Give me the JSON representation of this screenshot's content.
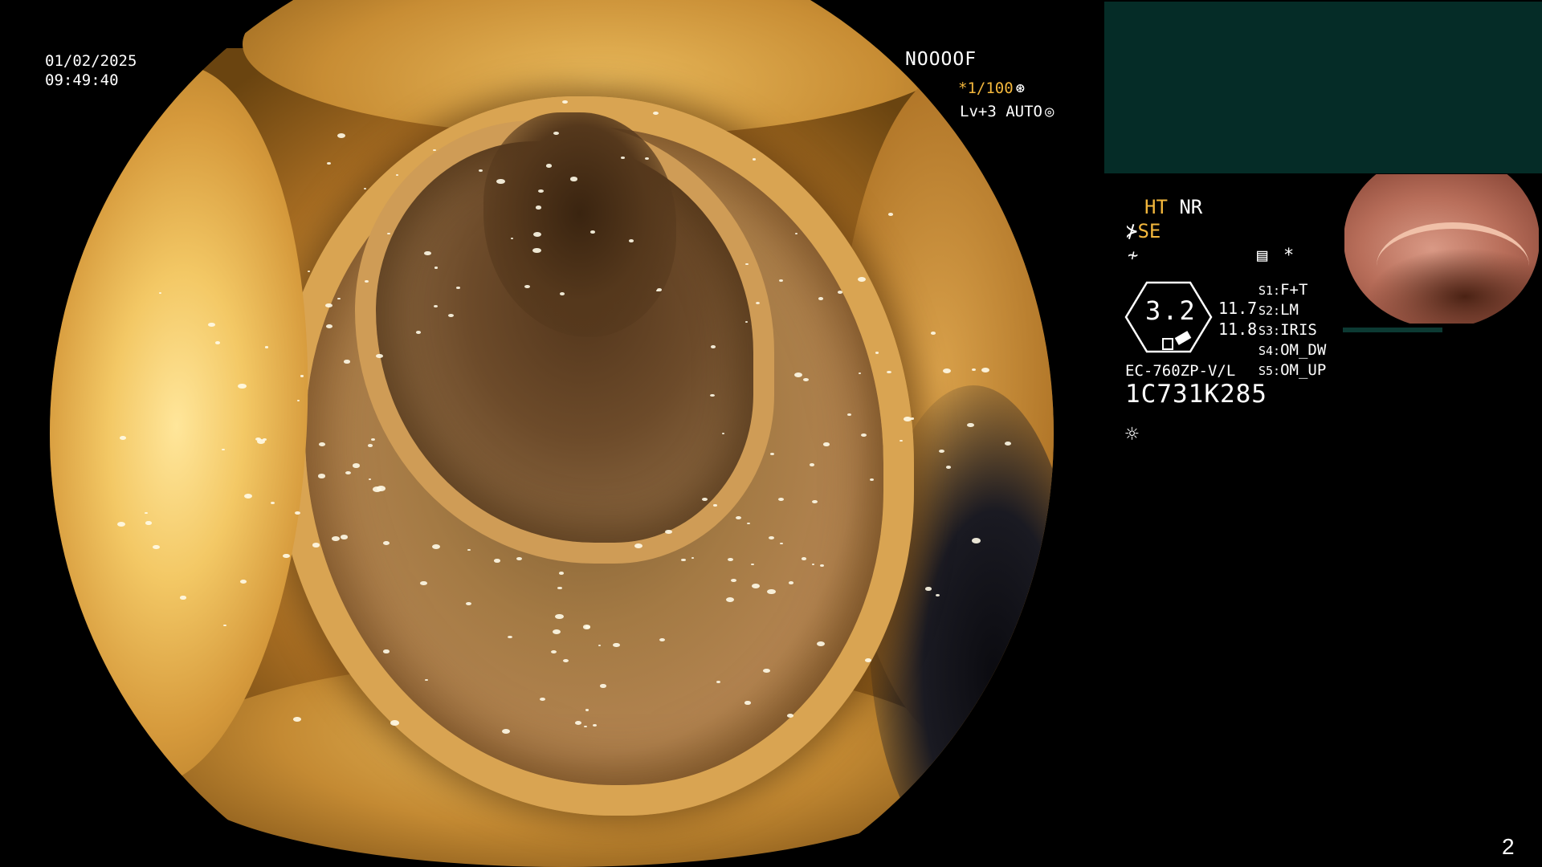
{
  "overlay": {
    "date": "01/02/2025",
    "time": "09:49:40",
    "mode_code": "NOOOOF",
    "zoom": "*1/100",
    "level": "Lv+3 AUTO"
  },
  "panel": {
    "ht": "HT",
    "nr": "NR",
    "se": "SE",
    "gauge_value": "3.2",
    "value_1": "11.7",
    "value_2": "11.8",
    "settings": [
      {
        "key": "S1:",
        "value": "F+T"
      },
      {
        "key": "S2:",
        "value": "LM"
      },
      {
        "key": "S3:",
        "value": "IRIS"
      },
      {
        "key": "S4:",
        "value": "OM_DW"
      },
      {
        "key": "S5:",
        "value": "OM_UP"
      }
    ],
    "scope_model": "EC-760ZP-V/L",
    "serial": "1C731K285"
  },
  "icons": {
    "shutter": "aperture-icon",
    "auto": "auto-iris-icon",
    "memo": "memo-icon",
    "sun": "brightness-icon",
    "filter": "filter-wave-icon",
    "se_symbol": "structure-enhance-icon"
  },
  "page_number": "2",
  "colors": {
    "accent_yellow": "#f3b73c",
    "panel_teal": "#052c27"
  }
}
